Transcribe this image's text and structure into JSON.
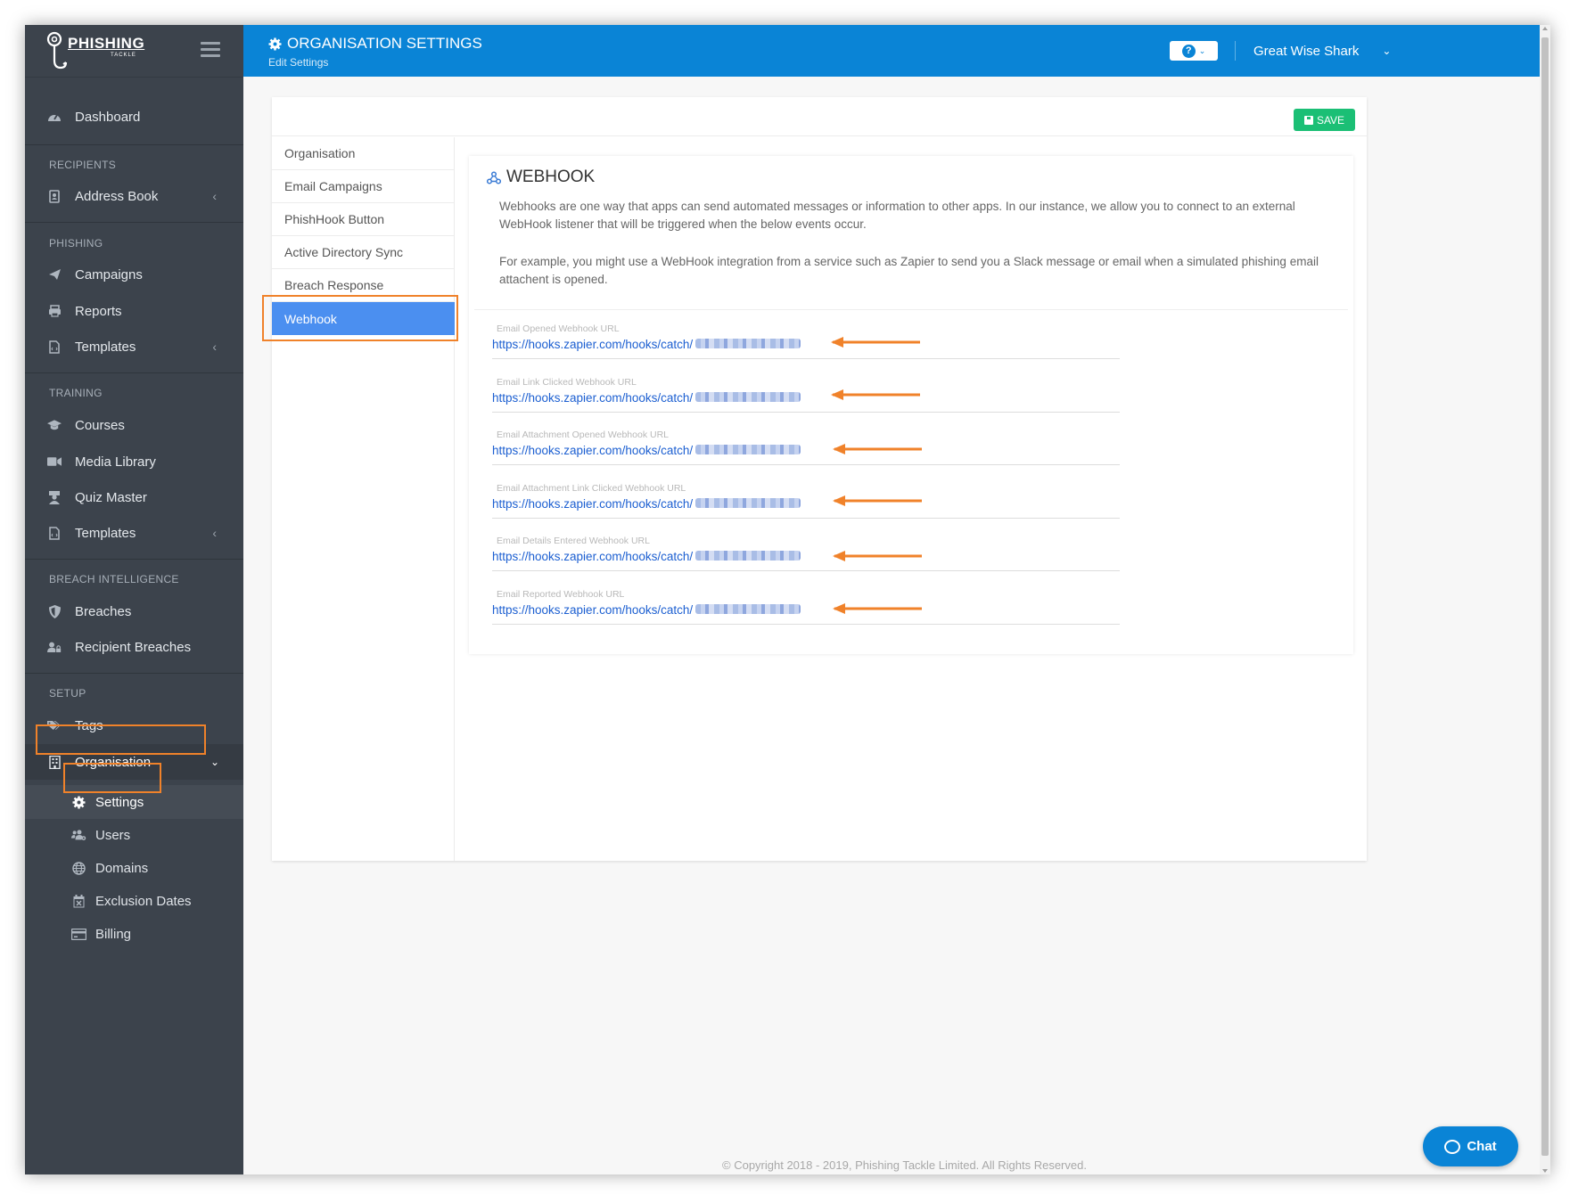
{
  "sidebar": {
    "logo": {
      "text": "PHISHING",
      "sub": "TACKLE"
    },
    "top_item": {
      "label": "Dashboard",
      "icon": "dashboard-icon"
    },
    "sections": [
      {
        "title": "RECIPIENTS",
        "items": [
          {
            "label": "Address Book",
            "icon": "address-book-icon",
            "expandable": true
          }
        ]
      },
      {
        "title": "PHISHING",
        "items": [
          {
            "label": "Campaigns",
            "icon": "paper-plane-icon"
          },
          {
            "label": "Reports",
            "icon": "print-icon"
          },
          {
            "label": "Templates",
            "icon": "file-code-icon",
            "expandable": true
          }
        ]
      },
      {
        "title": "TRAINING",
        "items": [
          {
            "label": "Courses",
            "icon": "graduation-cap-icon"
          },
          {
            "label": "Media Library",
            "icon": "video-icon"
          },
          {
            "label": "Quiz Master",
            "icon": "teacher-icon"
          },
          {
            "label": "Templates",
            "icon": "file-code-icon",
            "expandable": true
          }
        ]
      },
      {
        "title": "BREACH INTELLIGENCE",
        "items": [
          {
            "label": "Breaches",
            "icon": "shield-icon"
          },
          {
            "label": "Recipient Breaches",
            "icon": "user-lock-icon"
          }
        ]
      },
      {
        "title": "SETUP",
        "items": [
          {
            "label": "Tags",
            "icon": "tags-icon"
          },
          {
            "label": "Organisation",
            "icon": "building-icon",
            "expanded": true
          }
        ]
      }
    ],
    "organisation_sub": [
      {
        "label": "Settings",
        "icon": "gear-icon",
        "active": true
      },
      {
        "label": "Users",
        "icon": "users-cog-icon"
      },
      {
        "label": "Domains",
        "icon": "globe-icon"
      },
      {
        "label": "Exclusion Dates",
        "icon": "calendar-times-icon"
      },
      {
        "label": "Billing",
        "icon": "credit-card-icon"
      }
    ]
  },
  "header": {
    "title": "ORGANISATION SETTINGS",
    "subtitle": "Edit Settings",
    "help_label": "?",
    "user_name": "Great Wise Shark"
  },
  "toolbar": {
    "save_label": "SAVE"
  },
  "tabs": [
    {
      "label": "Organisation"
    },
    {
      "label": "Email Campaigns"
    },
    {
      "label": "PhishHook Button"
    },
    {
      "label": "Active Directory Sync"
    },
    {
      "label": "Breach Response"
    },
    {
      "label": "Webhook",
      "active": true
    }
  ],
  "webhook": {
    "title": "WEBHOOK",
    "desc1": "Webhooks are one way that apps can send automated messages or information to other apps. In our instance, we allow you to connect to an external WebHook listener that will be triggered when the below events occur.",
    "desc2": "For example, you might use a WebHook integration from a service such as Zapier to send you a Slack message or email when a simulated phishing email attachent is opened.",
    "fields": [
      {
        "label": "Email Opened Webhook URL",
        "value": "https://hooks.zapier.com/hooks/catch/"
      },
      {
        "label": "Email Link Clicked Webhook URL",
        "value": "https://hooks.zapier.com/hooks/catch/"
      },
      {
        "label": "Email Attachment Opened Webhook URL",
        "value": "https://hooks.zapier.com/hooks/catch/"
      },
      {
        "label": "Email Attachment Link Clicked Webhook URL",
        "value": "https://hooks.zapier.com/hooks/catch/"
      },
      {
        "label": "Email Details Entered Webhook URL",
        "value": "https://hooks.zapier.com/hooks/catch/"
      },
      {
        "label": "Email Reported Webhook URL",
        "value": "https://hooks.zapier.com/hooks/catch/"
      }
    ]
  },
  "footer": {
    "text": "© Copyright 2018 - 2019, Phishing Tackle Limited. All Rights Reserved."
  },
  "chat": {
    "label": "Chat"
  },
  "colors": {
    "header": "#0a84d6",
    "sidebar": "#3c434c",
    "active_tab": "#4b8ff0",
    "save": "#1bbf75",
    "highlight": "#f0822a",
    "link": "#1c5fd1"
  }
}
